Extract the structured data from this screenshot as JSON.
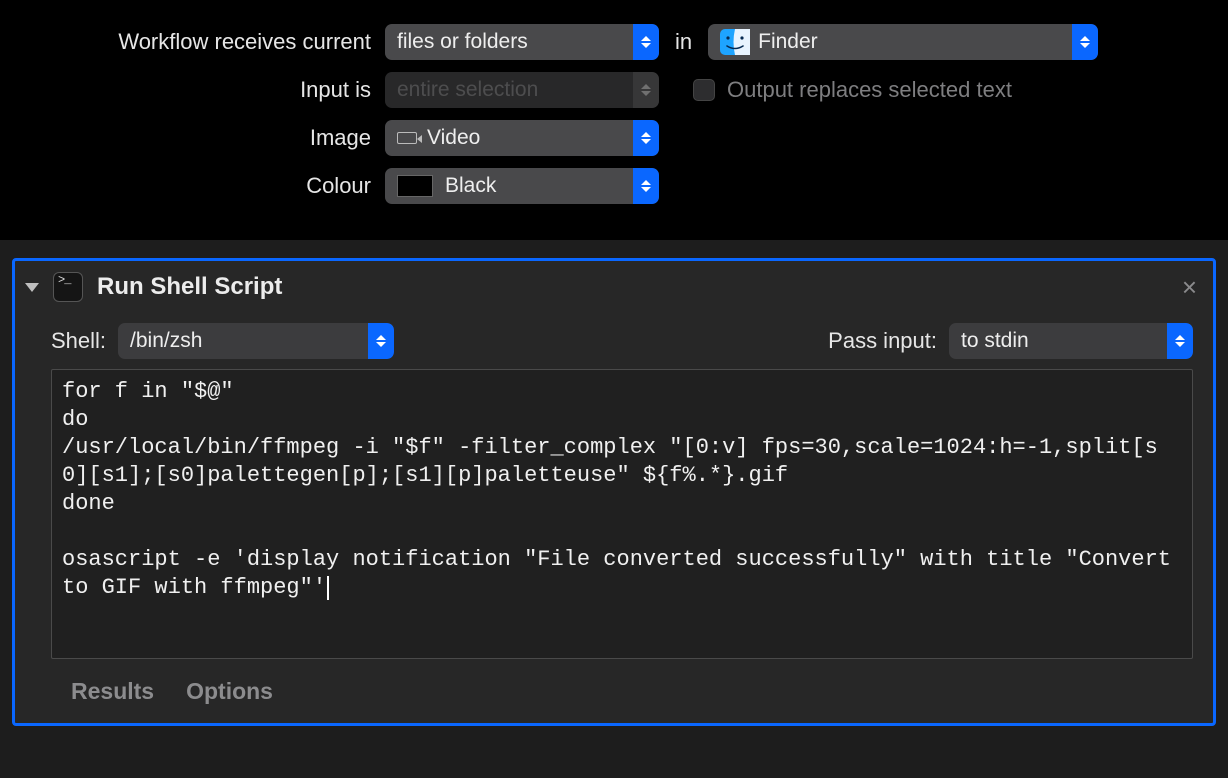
{
  "settings": {
    "receives_label": "Workflow receives current",
    "receives_value": "files or folders",
    "in_label": "in",
    "app_value": "Finder",
    "input_is_label": "Input is",
    "input_is_value": "entire selection",
    "output_replaces_label": "Output replaces selected text",
    "output_replaces_checked": false,
    "image_label": "Image",
    "image_value": "Video",
    "colour_label": "Colour",
    "colour_value": "Black"
  },
  "action": {
    "title": "Run Shell Script",
    "shell_label": "Shell:",
    "shell_value": "/bin/zsh",
    "pass_input_label": "Pass input:",
    "pass_input_value": "to stdin",
    "script": "for f in \"$@\"\ndo\n/usr/local/bin/ffmpeg -i \"$f\" -filter_complex \"[0:v] fps=30,scale=1024:h=-1,split[s0][s1];[s0]palettegen[p];[s1][p]paletteuse\" ${f%.*}.gif\ndone\n\nosascript -e 'display notification \"File converted successfully\" with title \"Convert to GIF with ffmpeg\"'",
    "footer": {
      "results": "Results",
      "options": "Options"
    }
  }
}
